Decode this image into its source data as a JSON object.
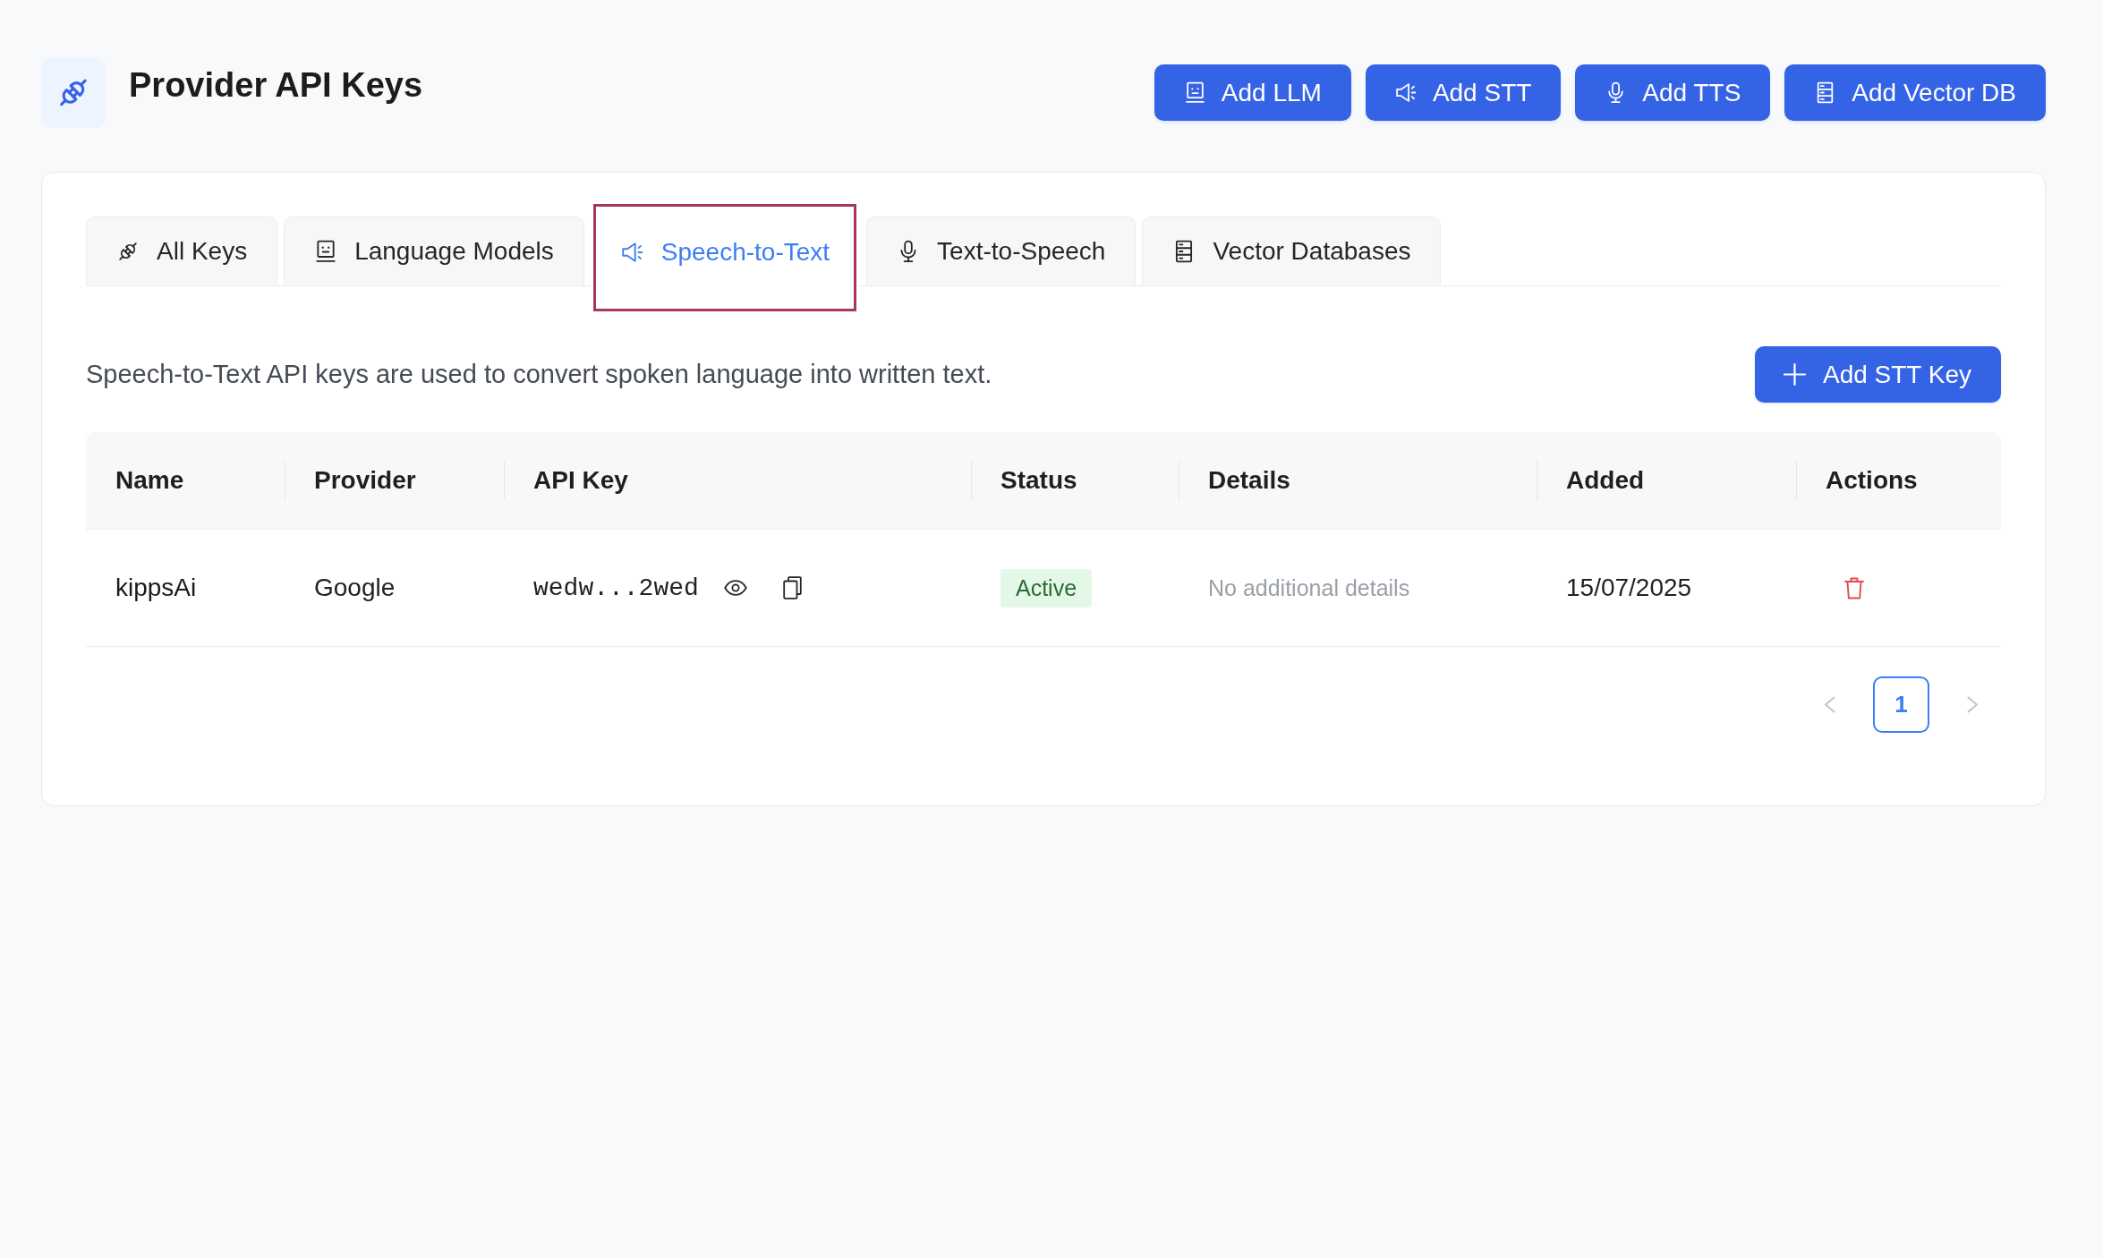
{
  "header": {
    "title": "Provider API Keys",
    "actions": [
      {
        "label": "Add LLM",
        "kind": "llm"
      },
      {
        "label": "Add STT",
        "kind": "stt"
      },
      {
        "label": "Add TTS",
        "kind": "tts"
      },
      {
        "label": "Add Vector DB",
        "kind": "vector"
      }
    ]
  },
  "tabs": [
    {
      "label": "All Keys",
      "kind": "all",
      "selected": false,
      "highlighted": false
    },
    {
      "label": "Language Models",
      "kind": "llm",
      "selected": false,
      "highlighted": false
    },
    {
      "label": "Speech-to-Text",
      "kind": "stt",
      "selected": true,
      "highlighted": true
    },
    {
      "label": "Text-to-Speech",
      "kind": "tts",
      "selected": false,
      "highlighted": false
    },
    {
      "label": "Vector Databases",
      "kind": "vector",
      "selected": false,
      "highlighted": false
    }
  ],
  "description": "Speech-to-Text API keys are used to convert spoken language into written text.",
  "add_key_button": {
    "label": "Add STT Key"
  },
  "table": {
    "columns": [
      "Name",
      "Provider",
      "API Key",
      "Status",
      "Details",
      "Added",
      "Actions"
    ],
    "rows": [
      {
        "name": "kippsAi",
        "provider": "Google",
        "api_key": "wedw...2wed",
        "status": "Active",
        "details": "No additional details",
        "added": "15/07/2025"
      }
    ]
  },
  "pagination": {
    "prev": {
      "disabled": true
    },
    "pages": [
      {
        "label": "1",
        "selected": true
      }
    ],
    "next": {
      "disabled": true
    }
  }
}
